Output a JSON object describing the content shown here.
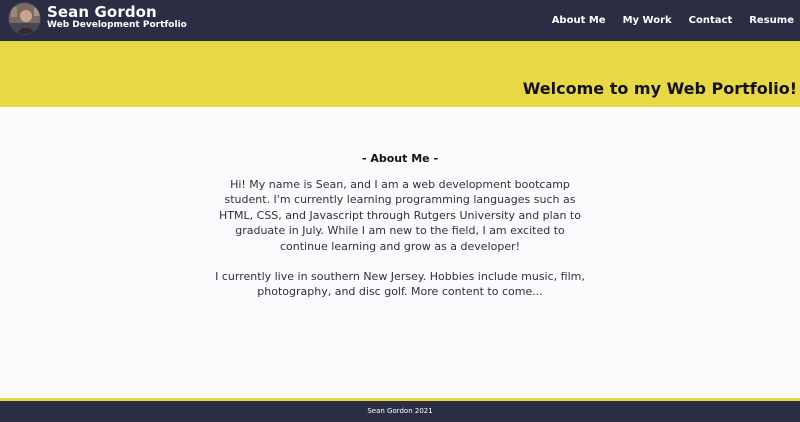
{
  "colors": {
    "header_bg": "#2b2d45",
    "accent_yellow": "#e8d843",
    "page_bg": "#fcfbfd"
  },
  "header": {
    "name": "Sean Gordon",
    "subtitle": "Web Development Portfolio",
    "avatar_icon": "profile-photo"
  },
  "nav": {
    "items": [
      {
        "label": "About Me"
      },
      {
        "label": "My Work"
      },
      {
        "label": "Contact"
      },
      {
        "label": "Resume"
      }
    ]
  },
  "banner": {
    "title": "Welcome to my Web Portfolio!"
  },
  "about": {
    "heading": "- About Me -",
    "paragraph1": "Hi! My name is Sean, and I am a web development bootcamp student. I'm currently learning programming languages such as HTML, CSS, and Javascript through Rutgers University and plan to graduate in July. While I am new to the field, I am excited to continue learning and grow as a developer!",
    "paragraph2": "I currently live in southern New Jersey. Hobbies include music, film, photography, and disc golf. More content to come..."
  },
  "footer": {
    "text": "Sean Gordon 2021"
  }
}
